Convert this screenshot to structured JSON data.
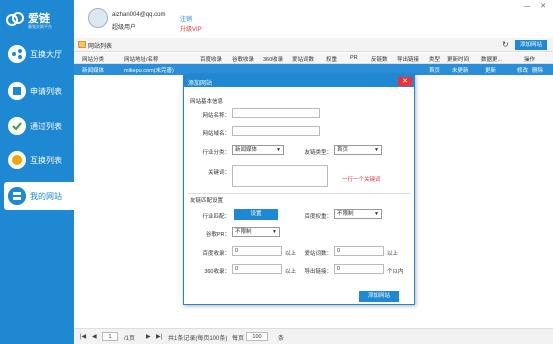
{
  "app": {
    "name": "爱链",
    "tagline": "最强交换平台"
  },
  "nav": [
    {
      "label": "互换大厅"
    },
    {
      "label": "申请列表"
    },
    {
      "label": "通过列表"
    },
    {
      "label": "互换列表"
    },
    {
      "label": "我的网站"
    }
  ],
  "user": {
    "email": "aizhan004@qq.com",
    "role": "超级用户",
    "logout": "注销",
    "upgrade": "升级VIP"
  },
  "window": {
    "minimize": "—",
    "close": "✕"
  },
  "tab": {
    "title": "网站列表",
    "refresh": "↻",
    "add_button": "添加网站"
  },
  "table": {
    "headers": [
      "网站分类",
      "网站地址/名称",
      "百度收录",
      "谷歌收录",
      "360收录",
      "爱站词数",
      "权重",
      "PR",
      "反链数",
      "导出链接",
      "类型",
      "更新时间",
      "数据更...",
      "操作"
    ],
    "rows": [
      {
        "category": "新闻媒体",
        "site": "mikepu.com(未完善)",
        "type": "首页",
        "update_time": "未更新",
        "data_update": "更新",
        "edit": "修改",
        "delete": "删除"
      }
    ]
  },
  "pager": {
    "first": "|◀",
    "prev": "◀",
    "page": "1",
    "total_pages": "/1页",
    "next": "▶",
    "last": "▶|",
    "summary": "共1条记录(每页100条)",
    "per_page_label": "每页",
    "per_page": "100",
    "per_page_unit": "条"
  },
  "modal": {
    "title": "添加网站",
    "close": "✕",
    "section_basic": "网站基本信息",
    "site_name_label": "网站名称：",
    "site_domain_label": "网站域名：",
    "industry_label": "行业分类：",
    "industry_value": "新闻媒体",
    "friendlink_type_label": "友链类型：",
    "friendlink_type_value": "首页",
    "keywords_label": "关键词：",
    "keywords_hint": "一行一个关键词",
    "section_match": "友链匹配设置",
    "industry_match_label": "行业匹配：",
    "industry_match_button": "设置",
    "baidu_weight_label": "百度权重：",
    "baidu_weight_value": "不限制",
    "google_pr_label": "谷歌PR：",
    "google_pr_value": "不限制",
    "baidu_index_label": "百度收录：",
    "baidu_index_value": "0",
    "baidu_index_unit": "以上",
    "aizhan_words_label": "爱站词数：",
    "aizhan_words_value": "0",
    "aizhan_words_unit": "以上",
    "so360_label": "360收录：",
    "so360_value": "0",
    "so360_unit": "以上",
    "export_links_label": "导出链接：",
    "export_links_value": "0",
    "export_links_unit": "个以内",
    "submit": "添加网站"
  },
  "colors": {
    "brand": "#1e88d3",
    "danger": "#e8333b"
  }
}
